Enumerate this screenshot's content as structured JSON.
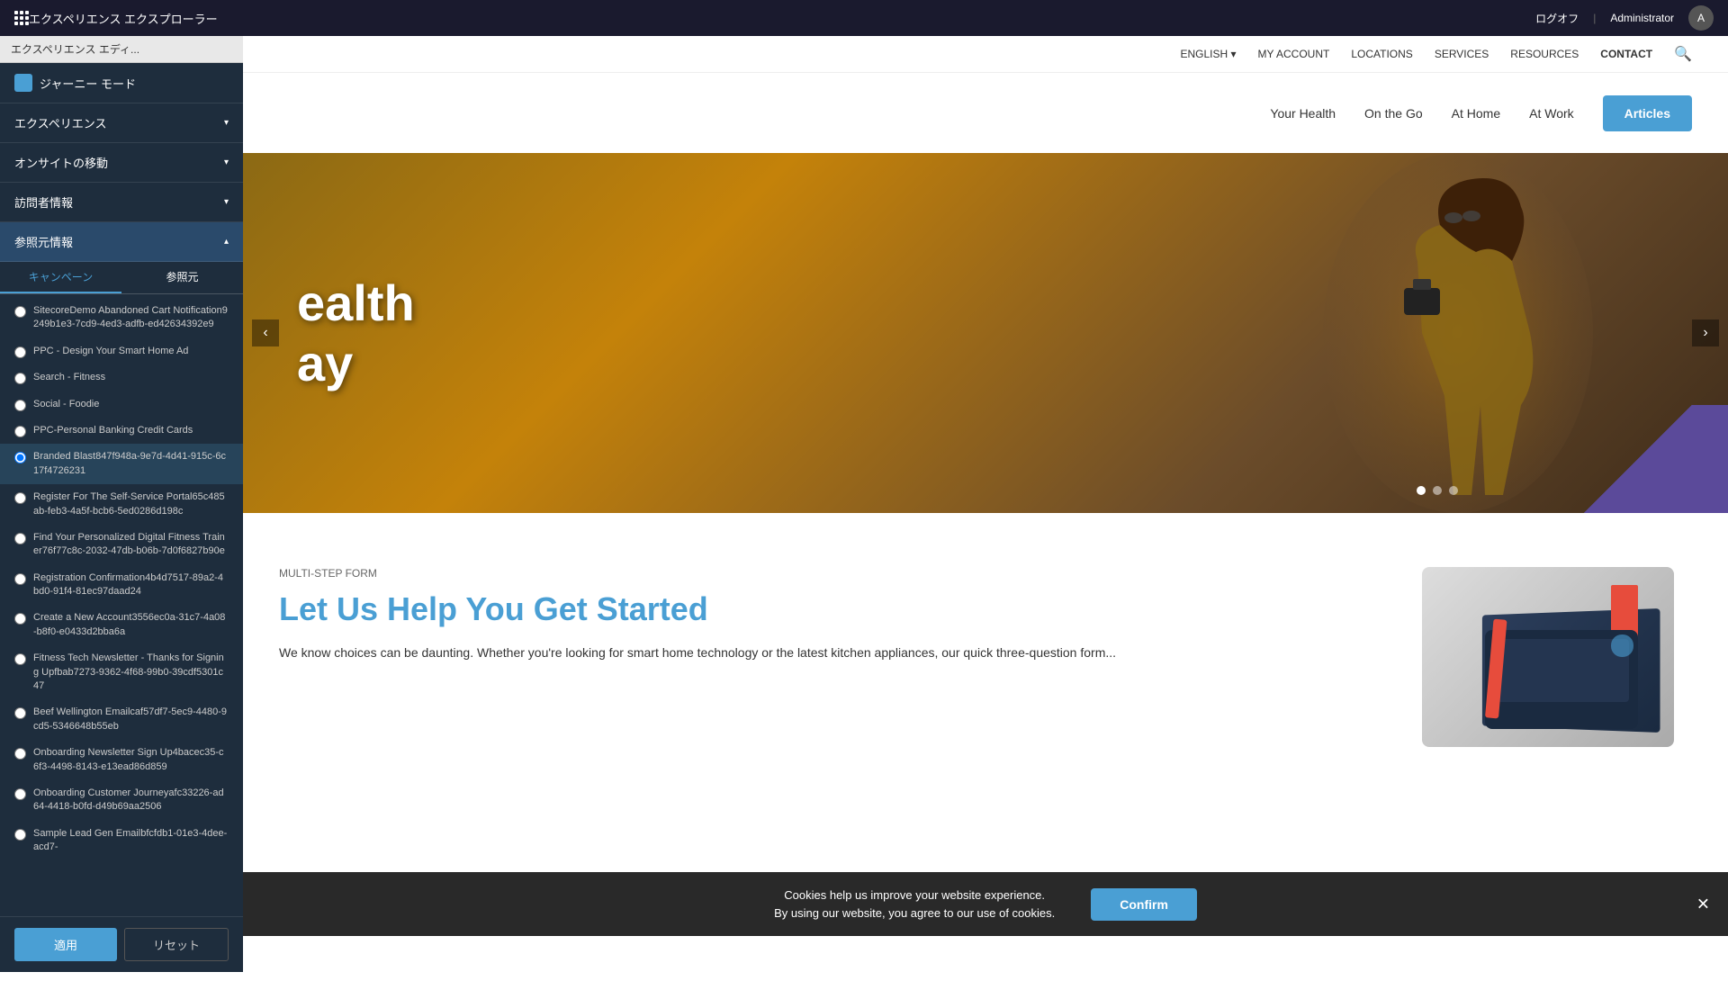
{
  "topbar": {
    "title": "エクスペリエンス エクスプローラー",
    "logout": "ログオフ",
    "separator": "|",
    "admin": "Administrator"
  },
  "editorbar": {
    "label": "エクスペリエンス エディ..."
  },
  "sidebar": {
    "journeyMode": "ジャーニー モード",
    "sections": [
      {
        "label": "エクスペリエンス",
        "expanded": true
      },
      {
        "label": "オンサイトの移動",
        "expanded": false
      },
      {
        "label": "訪問者情報",
        "expanded": false
      },
      {
        "label": "参照元情報",
        "active": true,
        "expanded": true
      }
    ],
    "tabs": [
      {
        "label": "キャンペーン",
        "active": true
      },
      {
        "label": "参照元",
        "active": false
      }
    ],
    "campaigns": [
      {
        "id": 1,
        "label": "SitecoreDemo Abandoned Cart Notification9249b1e3-7cd9-4ed3-adfb-ed42634392e9",
        "selected": false
      },
      {
        "id": 2,
        "label": "PPC - Design Your Smart Home Ad",
        "selected": false
      },
      {
        "id": 3,
        "label": "Search - Fitness",
        "selected": false
      },
      {
        "id": 4,
        "label": "Social - Foodie",
        "selected": false
      },
      {
        "id": 5,
        "label": "PPC-Personal Banking Credit Cards",
        "selected": false
      },
      {
        "id": 6,
        "label": "Branded Blast847f948a-9e7d-4d41-915c-6c17f4726231",
        "selected": true
      },
      {
        "id": 7,
        "label": "Register For The Self-Service Portal65c485ab-feb3-4a5f-bcb6-5ed0286d198c",
        "selected": false
      },
      {
        "id": 8,
        "label": "Find Your Personalized Digital Fitness Trainer76f77c8c-2032-47db-b06b-7d0f6827b90e",
        "selected": false
      },
      {
        "id": 9,
        "label": "Registration Confirmation4b4d7517-89a2-4bd0-91f4-81ec97daad24",
        "selected": false
      },
      {
        "id": 10,
        "label": "Create a New Account3556ec0a-31c7-4a08-b8f0-e0433d2bba6a",
        "selected": false
      },
      {
        "id": 11,
        "label": "Fitness Tech Newsletter - Thanks for Signing Upfbab7273-9362-4f68-99b0-39cdf5301c47",
        "selected": false
      },
      {
        "id": 12,
        "label": "Beef Wellington Emailcaf57df7-5ec9-4480-9cd5-5346648b55eb",
        "selected": false
      },
      {
        "id": 13,
        "label": "Onboarding Newsletter Sign Up4bacec35-c6f3-4498-8143-e13ead86d859",
        "selected": false
      },
      {
        "id": 14,
        "label": "Onboarding Customer Journeyafc33226-ad64-4418-b0fd-d49b69aa2506",
        "selected": false
      },
      {
        "id": 15,
        "label": "Sample Lead Gen Emailbfcfdb1-01e3-4dee-acd7-",
        "selected": false
      }
    ],
    "buttons": {
      "apply": "適用",
      "reset": "リセット"
    }
  },
  "website": {
    "nav": {
      "topItems": [
        "ENGLISH ▾",
        "MY ACCOUNT",
        "LOCATIONS",
        "SERVICES",
        "RESOURCES",
        "CONTACT"
      ],
      "links": [
        "Your Health",
        "On the Go",
        "At Home",
        "At Work"
      ],
      "cta": "Articles"
    },
    "hero": {
      "text1": "ealth",
      "text2": "ay"
    },
    "content": {
      "label": "Multi-Step Form",
      "title": "Let Us Help You Get Started",
      "text": "We know choices can be daunting. Whether you're looking for smart home technology or the latest kitchen appliances, our quick three-question form..."
    },
    "cookie": {
      "text1": "Cookies help us improve your website experience.",
      "text2": "By using our website, you agree to our use of cookies.",
      "confirm": "Confirm"
    }
  }
}
